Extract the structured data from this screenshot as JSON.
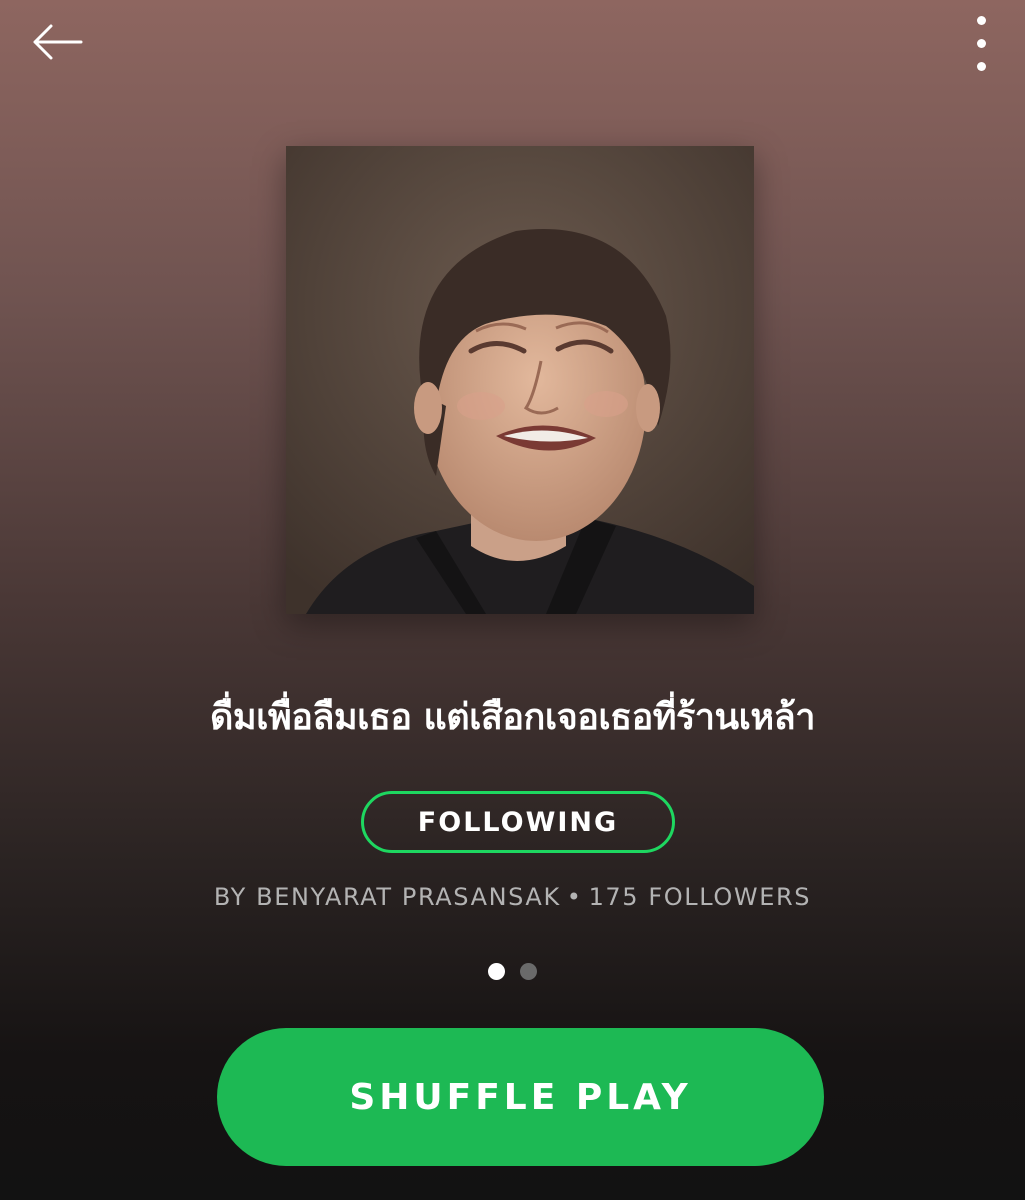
{
  "playlist": {
    "title": "ดื่มเพื่อลืมเธอ แต่เสือกเจอเธอที่ร้านเหล้า",
    "follow_label": "FOLLOWING",
    "byline_owner": "BY BENYARAT PRASANSAK",
    "byline_separator": "•",
    "byline_followers": "175 FOLLOWERS",
    "pager": {
      "pages": 2,
      "active_index": 0
    }
  },
  "actions": {
    "shuffle_play_label": "SHUFFLE PLAY"
  },
  "icons": {
    "back": "arrow-left-icon",
    "more": "more-vertical-icon"
  },
  "colors": {
    "accent_green": "#1db954",
    "follow_border": "#1ed760",
    "header_gradient_top": "#8e6660",
    "background_bottom": "#121212",
    "secondary_text": "#b3b3b3"
  }
}
